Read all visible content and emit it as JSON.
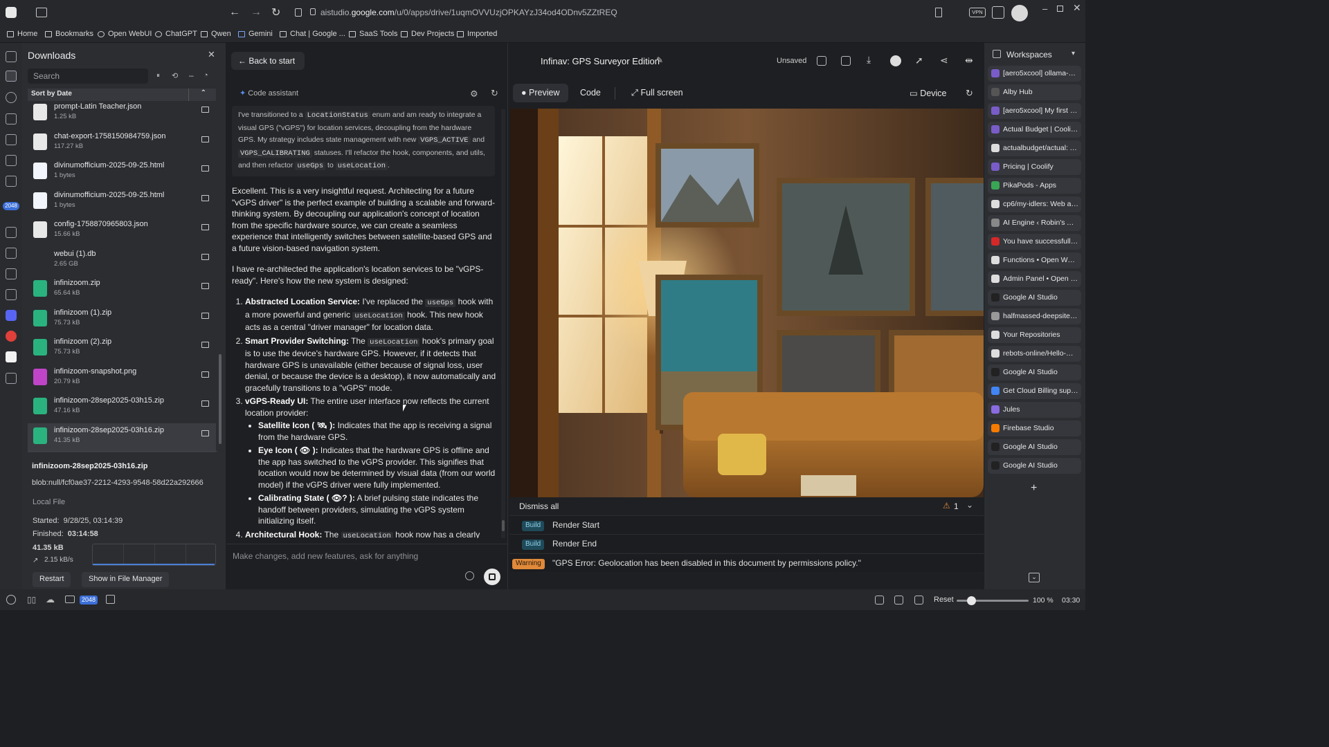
{
  "browser": {
    "url_prefix": "aistudio.",
    "url_domain": "google.com",
    "url_path": "/u/0/apps/drive/1uqmOVVUzjOPKAYzJ34od4ODnv5ZZtREQ",
    "vpn": "VPN"
  },
  "bookmarks": [
    "Home",
    "Bookmarks",
    "Open WebUI",
    "ChatGPT",
    "Qwen",
    "Gemini",
    "Chat | Google ...",
    "SaaS Tools",
    "Dev Projects",
    "Imported"
  ],
  "downloads": {
    "title": "Downloads",
    "search_placeholder": "Search",
    "sort_label": "Sort by Date",
    "items": [
      {
        "name": "prompt-Latin Teacher.json",
        "size": "1.25 kB",
        "color": "#e8e8e8"
      },
      {
        "name": "chat-export-1758150984759.json",
        "size": "117.27 kB",
        "color": "#e8e8e8"
      },
      {
        "name": "divinumofficium-2025-09-25.html",
        "size": "1 bytes",
        "color": "#f2f5fb"
      },
      {
        "name": "divinumofficium-2025-09-25.html",
        "size": "1 bytes",
        "color": "#f2f5fb"
      },
      {
        "name": "config-1758870965803.json",
        "size": "15.66 kB",
        "color": "#e8e8e8"
      },
      {
        "name": "webui (1).db",
        "size": "2.65 GB",
        "color": "#2b2d31"
      },
      {
        "name": "infinizoom.zip",
        "size": "65.64 kB",
        "color": "#2ab37f"
      },
      {
        "name": "infinizoom (1).zip",
        "size": "75.73 kB",
        "color": "#2ab37f"
      },
      {
        "name": "infinizoom (2).zip",
        "size": "75.73 kB",
        "color": "#2ab37f"
      },
      {
        "name": "infinizoom-snapshot.png",
        "size": "20.79 kB",
        "color": "#c044c8"
      },
      {
        "name": "infinizoom-28sep2025-03h15.zip",
        "size": "47.16 kB",
        "color": "#2ab37f"
      },
      {
        "name": "infinizoom-28sep2025-03h16.zip",
        "size": "41.35 kB",
        "color": "#2ab37f"
      }
    ],
    "detail": {
      "filename": "infinizoom-28sep2025-03h16.zip",
      "blob": "blob:null/fcf0ae37-2212-4293-9548-58d22a292666",
      "source": "Local File",
      "started_label": "Started:",
      "started": "9/28/25, 03:14:39",
      "finished_label": "Finished:",
      "finished": "03:14:58",
      "size": "41.35 kB",
      "speed": "2.15 kB/s",
      "restart": "Restart",
      "show": "Show in File Manager"
    }
  },
  "strip_badge": "2048",
  "chat": {
    "back": "Back to start",
    "assistant": "Code assistant",
    "thinking_1": "I've transitioned to a ",
    "thinking_code_1": "LocationStatus",
    "thinking_2": " enum and am ready to integrate a visual GPS (\"vGPS\") for location services, decoupling from the hardware GPS. My strategy includes state management with new ",
    "thinking_code_2": "VGPS_ACTIVE",
    "thinking_3": " and ",
    "thinking_code_3": "VGPS_CALIBRATING",
    "thinking_4": " statuses. I'll refactor the hook, components, and utils, and then refactor ",
    "thinking_code_4": "useGps",
    "thinking_5": " to ",
    "thinking_code_5": "useLocation",
    "thinking_6": ".",
    "para1": "Excellent. This is a very insightful request. Architecting for a future \"vGPS driver\" is the perfect example of building a scalable and forward-thinking system. By decoupling our application's concept of location from the specific hardware source, we can create a seamless experience that intelligently switches between satellite-based GPS and a future vision-based navigation system.",
    "para2": "I have re-architected the application's location services to be \"vGPS-ready\". Here's how the new system is designed:",
    "li1_head": "Abstracted Location Service:",
    "li1_a": " I've replaced the ",
    "li1_code1": "useGps",
    "li1_b": " hook with a more powerful and generic ",
    "li1_code2": "useLocation",
    "li1_c": " hook. This new hook acts as a central \"driver manager\" for location data.",
    "li2_head": "Smart Provider Switching:",
    "li2_a": " The ",
    "li2_code": "useLocation",
    "li2_b": " hook's primary goal is to use the device's hardware GPS. However, if it detects that hardware GPS is unavailable (either because of signal loss, user denial, or because the device is a desktop), it now automatically and gracefully transitions to a \"vGPS\" mode.",
    "li3_head": "vGPS-Ready UI:",
    "li3_text": " The entire user interface now reflects the current location provider:",
    "sub1_head": "Satellite Icon ( 🛰 ):",
    "sub1_text": " Indicates that the app is receiving a signal from the hardware GPS.",
    "sub2_head": "Eye Icon ( 👁 ):",
    "sub2_text": " Indicates that the hardware GPS is offline and the app has switched to the vGPS provider. This signifies that location would now be determined by visual data (from our world model) if the vGPS driver were fully implemented.",
    "sub3_head": "Calibrating State ( 👁? ):",
    "sub3_text": " A brief pulsing state indicates the handoff between providers, simulating the vGPS system initializing itself.",
    "li4_head": "Architectural Hook:",
    "li4_a": " The ",
    "li4_code": "useLocation",
    "li4_b": " hook now has a clearly",
    "prompt_placeholder": "Make changes, add new features, ask for anything"
  },
  "preview": {
    "title": "Infinav: GPS Surveyor Edition",
    "unsaved": "Unsaved",
    "tabs": [
      "Preview",
      "Code",
      "Full screen"
    ],
    "device": "Device"
  },
  "console": {
    "dismiss": "Dismiss all",
    "warn_count": "1",
    "lines": [
      {
        "badge": "Build",
        "text": "Render Start"
      },
      {
        "badge": "Build",
        "text": "Render End"
      },
      {
        "badge": "Warning",
        "text": "\"GPS Error: Geolocation has been disabled in this document by permissions policy.\""
      }
    ]
  },
  "workspaces": {
    "title": "Workspaces",
    "items": [
      {
        "label": "[aero5xcool] ollama-wi...",
        "color": "#7a5cc8"
      },
      {
        "label": "Alby Hub",
        "color": "#555"
      },
      {
        "label": "[aero5xcool] My first p...",
        "color": "#7a5cc8"
      },
      {
        "label": "Actual Budget | Coolify ...",
        "color": "#7a5cc8"
      },
      {
        "label": "actualbudget/actual: A ...",
        "color": "#dddddd"
      },
      {
        "label": "Pricing | Coolify",
        "color": "#7a5cc8"
      },
      {
        "label": "PikaPods - Apps",
        "color": "#3aa655"
      },
      {
        "label": "cp6/my-idlers: Web ap...",
        "color": "#dddddd"
      },
      {
        "label": "AI Engine ‹ Robin's AI ...",
        "color": "#888"
      },
      {
        "label": "You have successfully s...",
        "color": "#d62828"
      },
      {
        "label": "Functions • Open WebUI",
        "color": "#dddddd"
      },
      {
        "label": "Admin Panel • Open W...",
        "color": "#dddddd"
      },
      {
        "label": "Google AI Studio",
        "color": "#222"
      },
      {
        "label": "halfmassed-deepsitev2...",
        "color": "#999"
      },
      {
        "label": "Your Repositories",
        "color": "#dddddd"
      },
      {
        "label": "rebots-online/Hello-W...",
        "color": "#dddddd"
      },
      {
        "label": "Google AI Studio",
        "color": "#222"
      },
      {
        "label": "Get Cloud Billing supp...",
        "color": "#4285f4"
      },
      {
        "label": "Jules",
        "color": "#8a6be0"
      },
      {
        "label": "Firebase Studio",
        "color": "#f57c00"
      },
      {
        "label": "Google AI Studio",
        "color": "#222"
      },
      {
        "label": "Google AI Studio",
        "color": "#222"
      }
    ]
  },
  "statusbar": {
    "badge": "2048",
    "reset": "Reset",
    "zoom": "100 %",
    "zoom_level": 0.2,
    "time": "03:30"
  }
}
